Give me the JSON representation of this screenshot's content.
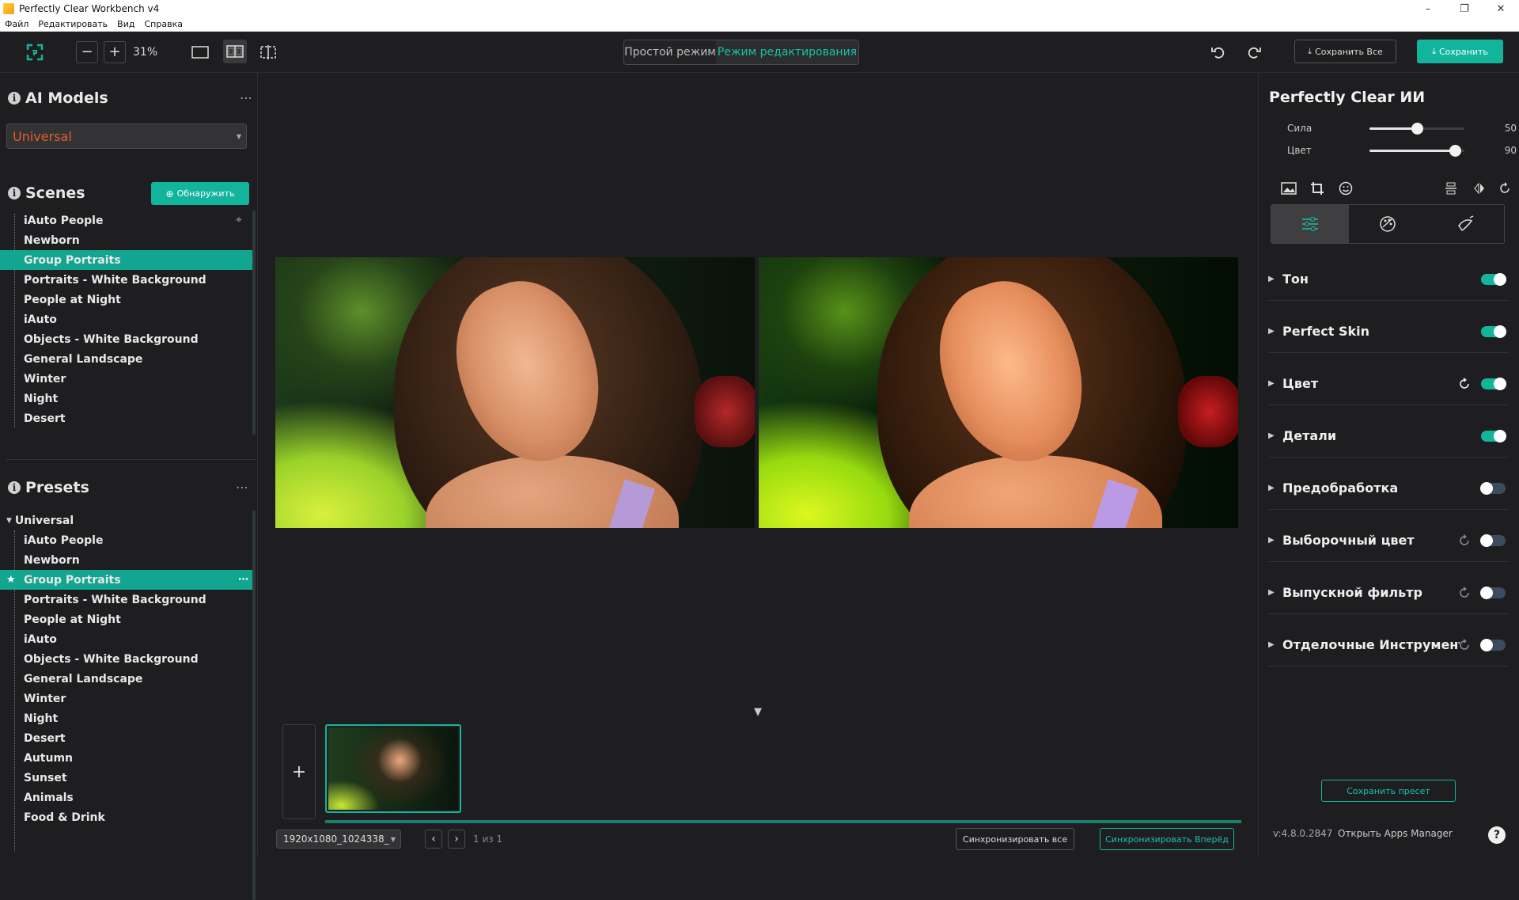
{
  "window": {
    "title": "Perfectly Clear Workbench v4",
    "controls": [
      "–",
      "❐",
      "✕"
    ]
  },
  "menu": [
    "Файл",
    "Редактировать",
    "Вид",
    "Справка"
  ],
  "toolbar": {
    "zoom": "31%",
    "minus": "−",
    "plus": "+",
    "mode_simple": "Простой режим",
    "mode_edit": "Режим редактирования",
    "save_all": "Сохранить Все",
    "save": "Сохранить"
  },
  "ai_models": {
    "title": "AI Models",
    "selected": "Universal"
  },
  "scenes": {
    "title": "Scenes",
    "detect_label": "Обнаружить",
    "items": [
      "iAuto People",
      "Newborn",
      "Group Portraits",
      "Portraits - White Background",
      "People at Night",
      "iAuto",
      "Objects - White Background",
      "General Landscape",
      "Winter",
      "Night",
      "Desert"
    ],
    "selected": "Group Portraits"
  },
  "presets": {
    "title": "Presets",
    "group": "Universal",
    "items": [
      "iAuto People",
      "Newborn",
      "Group Portraits",
      "Portraits - White Background",
      "People at Night",
      "iAuto",
      "Objects - White Background",
      "General Landscape",
      "Winter",
      "Night",
      "Desert",
      "Autumn",
      "Sunset",
      "Animals",
      "Food & Drink"
    ],
    "selected": "Group Portraits"
  },
  "center": {
    "file_name": "1920x1080_1024338_",
    "page": "1 из 1",
    "sync_all": "Синхронизировать все",
    "sync_forward": "Синхронизировать Вперёд"
  },
  "right": {
    "title": "Perfectly Clear ИИ",
    "sliders": [
      {
        "label": "Сила",
        "value": 50,
        "max": 100
      },
      {
        "label": "Цвет",
        "value": 90,
        "max": 100
      }
    ],
    "sections": [
      {
        "name": "Тон",
        "on": true,
        "reset": false
      },
      {
        "name": "Perfect Skin",
        "on": true,
        "reset": false
      },
      {
        "name": "Цвет",
        "on": true,
        "reset": true
      },
      {
        "name": "Детали",
        "on": true,
        "reset": false
      },
      {
        "name": "Предобработка",
        "on": false,
        "reset": false
      },
      {
        "name": "Выборочный цвет",
        "on": false,
        "reset": true
      },
      {
        "name": "Выпускной фильтр",
        "on": false,
        "reset": true
      },
      {
        "name": "Отделочные Инструменты",
        "on": false,
        "reset": true
      }
    ],
    "save_preset": "Сохранить пресет",
    "version": "v:4.8.0.2847",
    "apps_manager": "Открыть Apps Manager",
    "help": "?"
  },
  "colors": {
    "accent": "#12b59c",
    "model_text": "#e45d2c",
    "bg": "#1e1e20"
  }
}
